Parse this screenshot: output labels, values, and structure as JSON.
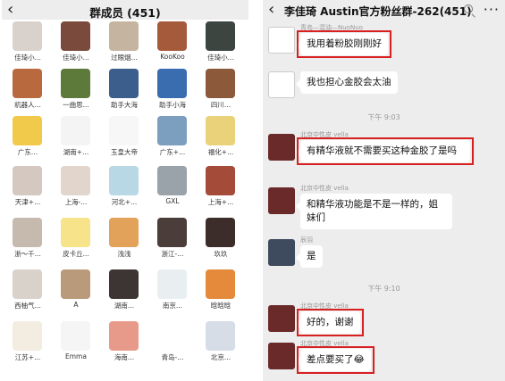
{
  "members_screen": {
    "title": "群成员 (451)",
    "back_icon": "chevron-left-icon",
    "members": [
      {
        "name": "佳琦小...",
        "color": "#d9d2cc"
      },
      {
        "name": "佳琦小...",
        "color": "#7a4a3c"
      },
      {
        "name": "过眼烟...",
        "color": "#c5b5a0"
      },
      {
        "name": "KooKoo",
        "color": "#a65a3c"
      },
      {
        "name": "佳琦小...",
        "color": "#3d4540"
      },
      {
        "name": "机器人...",
        "color": "#b86a3e"
      },
      {
        "name": "一曲思...",
        "color": "#5d7a3a"
      },
      {
        "name": "助手大海",
        "color": "#3b5e8c"
      },
      {
        "name": "助手小海",
        "color": "#3a6cb0"
      },
      {
        "name": "四川...",
        "color": "#8c5a3a"
      },
      {
        "name": "广东...",
        "color": "#f1c94b"
      },
      {
        "name": "湖南+...",
        "color": "#f4f4f4"
      },
      {
        "name": "玉皇大帝",
        "color": "#f7f7f7"
      },
      {
        "name": "广东+...",
        "color": "#7c9fc0"
      },
      {
        "name": "福化+...",
        "color": "#e9d27a"
      },
      {
        "name": "天津+...",
        "color": "#d4c8c0"
      },
      {
        "name": "上海-...",
        "color": "#e2d5cc"
      },
      {
        "name": "河北+...",
        "color": "#b7d8e4"
      },
      {
        "name": "GXL",
        "color": "#9aa3aa"
      },
      {
        "name": "上海+...",
        "color": "#a54b3a"
      },
      {
        "name": "浙～千...",
        "color": "#c6b9ae"
      },
      {
        "name": "皮卡丘...",
        "color": "#f6e38a"
      },
      {
        "name": "浅浅",
        "color": "#e2a25a"
      },
      {
        "name": "浙江-...",
        "color": "#4b3d3a"
      },
      {
        "name": "玖玖",
        "color": "#3c2d2a"
      },
      {
        "name": "西柚气...",
        "color": "#d8d2ca"
      },
      {
        "name": "A",
        "color": "#b99a7a"
      },
      {
        "name": "湖南...",
        "color": "#3c3534"
      },
      {
        "name": "南京...",
        "color": "#e9eef0"
      },
      {
        "name": "晗晗晗",
        "color": "#e48a3a"
      },
      {
        "name": "江苏+...",
        "color": "#f3ece0"
      },
      {
        "name": "Emma",
        "color": "#f5f5f5"
      },
      {
        "name": "海南...",
        "color": "#e89a8a"
      },
      {
        "name": "青岛-...",
        "color": "#ffffff"
      },
      {
        "name": "北京...",
        "color": "#d6dde6"
      }
    ]
  },
  "chat_screen": {
    "title": "李佳琦 Austin官方粉丝群-262(451)",
    "back_icon": "chevron-left-icon",
    "search_icon": "search-icon",
    "more_icon": "more-icon",
    "more_label": "···",
    "messages": [
      {
        "sender": "青岛—混油—NuoNuo",
        "text": "我用着粉胶刚刚好",
        "highlight": true
      },
      {
        "sender": "",
        "text": "我也担心金胶会太油",
        "highlight": false
      },
      {
        "time": "下午 9:03"
      },
      {
        "sender": "北京中性皮 vella",
        "text": "有精华液就不需要买这种金胶了是吗",
        "highlight": true
      },
      {
        "sender": "北京中性皮 vella",
        "text": "和精华液功能是不是一样的，姐妹们",
        "highlight": false
      },
      {
        "sender": "辰羽",
        "text": "是",
        "highlight": false
      },
      {
        "time": "下午 9:10"
      },
      {
        "sender": "北京中性皮 vella",
        "text": "好的，谢谢",
        "highlight": true
      },
      {
        "sender": "北京中性皮 vella",
        "text": "差点要买了😂",
        "highlight": true
      }
    ]
  }
}
